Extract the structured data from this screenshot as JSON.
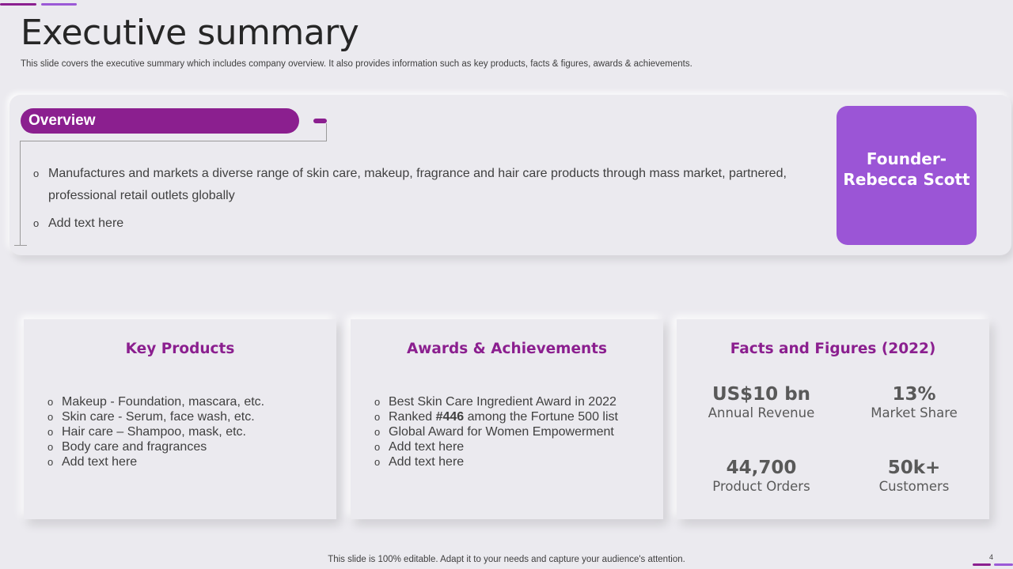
{
  "slide": {
    "title": "Executive summary",
    "subtitle": "This slide covers the executive summary which includes company overview. It also provides information such as key products, facts & figures, awards & achievements.",
    "footer": "This slide is 100% editable. Adapt it to your needs and capture your audience's attention.",
    "page_number": "4"
  },
  "overview": {
    "heading": "Overview",
    "items": [
      "Manufactures  and markets a diverse range of skin care, makeup, fragrance and hair care products through  mass market, partnered, professional retail outlets  globally",
      "Add text here"
    ]
  },
  "founder": {
    "text": "Founder-\nRebecca Scott"
  },
  "key_products": {
    "title": "Key Products",
    "items": [
      "Makeup - Foundation, mascara, etc.",
      "Skin care - Serum, face wash,  etc.",
      "Hair care – Shampoo, mask, etc.",
      "Body care and fragrances",
      "Add text here"
    ]
  },
  "awards": {
    "title": "Awards & Achievements",
    "items": [
      "Best Skin Care Ingredient Award in 2022",
      {
        "before": "Ranked ",
        "bold": "#446",
        "after": " among the Fortune 500 list"
      },
      "Global Award for Women Empowerment",
      "Add text here",
      "Add text here"
    ]
  },
  "facts": {
    "title": "Facts and Figures (2022)",
    "stats": [
      {
        "value": "US$10 bn",
        "label": "Annual Revenue"
      },
      {
        "value": "13%",
        "label": "Market Share"
      },
      {
        "value": "44,700",
        "label": "Product Orders"
      },
      {
        "value": "50k+",
        "label": "Customers"
      }
    ]
  },
  "colors": {
    "accent": "#8b1f8f",
    "founder_box": "#9b55d6",
    "background": "#ebeaef"
  },
  "icons": {
    "bullet": "hollow-circle-bullet"
  },
  "bullet_glyph": "o"
}
